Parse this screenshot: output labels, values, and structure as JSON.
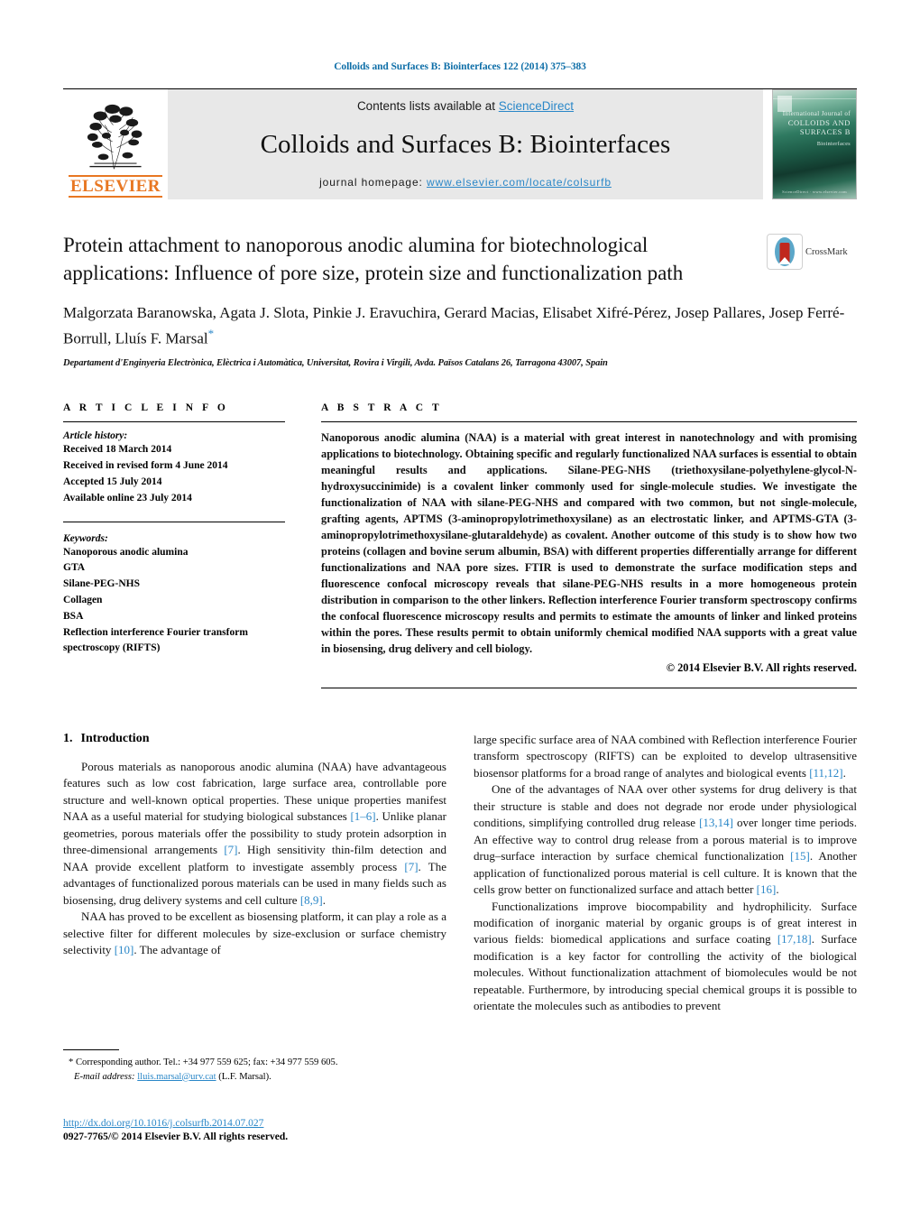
{
  "running_head": "Colloids and Surfaces B: Biointerfaces 122 (2014) 375–383",
  "banner": {
    "contents_prefix": "Contents lists available at ",
    "sciencedirect": "ScienceDirect",
    "journal_title": "Colloids and Surfaces B: Biointerfaces",
    "homepage_prefix": "journal homepage: ",
    "homepage_url": "www.elsevier.com/locate/colsurfb",
    "publisher": "ELSEVIER",
    "cover_title_line1": "International Journal of",
    "cover_title_line2": "COLLOIDS AND",
    "cover_title_line3": "SURFACES B",
    "cover_subtitle": "Biointerfaces",
    "cover_footer": "ScienceDirect  ·  www.elsevier.com"
  },
  "article": {
    "title": "Protein attachment to nanoporous anodic alumina for biotechnological applications: Influence of pore size, protein size and functionalization path",
    "crossmark_label": "CrossMark",
    "authors": "Malgorzata Baranowska, Agata J. Slota, Pinkie J. Eravuchira, Gerard Macias, Elisabet Xifré-Pérez, Josep Pallares, Josep Ferré-Borrull, Lluís F. Marsal",
    "corresponding_marker": "*",
    "affiliation": "Departament d'Enginyeria Electrònica, Elèctrica i Automàtica, Universitat, Rovira i Virgili, Avda. Països Catalans 26, Tarragona 43007, Spain"
  },
  "article_info": {
    "heading": "A R T I C L E    I N F O",
    "history_label": "Article history:",
    "history": [
      "Received 18 March 2014",
      "Received in revised form 4 June 2014",
      "Accepted 15 July 2014",
      "Available online 23 July 2014"
    ],
    "keywords_label": "Keywords:",
    "keywords": [
      "Nanoporous anodic alumina",
      "GTA",
      "Silane-PEG-NHS",
      "Collagen",
      "BSA",
      "Reflection interference Fourier transform spectroscopy (RIFTS)"
    ]
  },
  "abstract": {
    "heading": "A B S T R A C T",
    "body": "Nanoporous anodic alumina (NAA) is a material with great interest in nanotechnology and with promising applications to biotechnology. Obtaining specific and regularly functionalized NAA surfaces is essential to obtain meaningful results and applications. Silane-PEG-NHS (triethoxysilane-polyethylene-glycol-N-hydroxysuccinimide) is a covalent linker commonly used for single-molecule studies. We investigate the functionalization of NAA with silane-PEG-NHS and compared with two common, but not single-molecule, grafting agents, APTMS (3-aminopropylotrimethoxysilane) as an electrostatic linker, and APTMS-GTA (3-aminopropylotrimethoxysilane-glutaraldehyde) as covalent. Another outcome of this study is to show how two proteins (collagen and bovine serum albumin, BSA) with different properties differentially arrange for different functionalizations and NAA pore sizes. FTIR is used to demonstrate the surface modification steps and fluorescence confocal microscopy reveals that silane-PEG-NHS results in a more homogeneous protein distribution in comparison to the other linkers. Reflection interference Fourier transform spectroscopy confirms the confocal fluorescence microscopy results and permits to estimate the amounts of linker and linked proteins within the pores. These results permit to obtain uniformly chemical modified NAA supports with a great value in biosensing, drug delivery and cell biology.",
    "copyright": "© 2014 Elsevier B.V. All rights reserved."
  },
  "introduction": {
    "number": "1.",
    "heading": "Introduction",
    "left_paragraphs": [
      "Porous materials as nanoporous anodic alumina (NAA) have advantageous features such as low cost fabrication, large surface area, controllable pore structure and well-known optical properties. These unique properties manifest NAA as a useful material for studying biological substances [1–6]. Unlike planar geometries, porous materials offer the possibility to study protein adsorption in three-dimensional arrangements [7]. High sensitivity thin-film detection and NAA provide excellent platform to investigate assembly process [7]. The advantages of functionalized porous materials can be used in many fields such as biosensing, drug delivery systems and cell culture [8,9].",
      "NAA has proved to be excellent as biosensing platform, it can play a role as a selective filter for different molecules by size-exclusion or surface chemistry selectivity [10]. The advantage of"
    ],
    "right_paragraphs": [
      "large specific surface area of NAA combined with Reflection interference Fourier transform spectroscopy (RIFTS) can be exploited to develop ultrasensitive biosensor platforms for a broad range of analytes and biological events [11,12].",
      "One of the advantages of NAA over other systems for drug delivery is that their structure is stable and does not degrade nor erode under physiological conditions, simplifying controlled drug release [13,14] over longer time periods. An effective way to control drug release from a porous material is to improve drug–surface interaction by surface chemical functionalization [15]. Another application of functionalized porous material is cell culture. It is known that the cells grow better on functionalized surface and attach better [16].",
      "Functionalizations improve biocompability and hydrophilicity. Surface modification of inorganic material by organic groups is of great interest in various fields: biomedical applications and surface coating [17,18]. Surface modification is a key factor for controlling the activity of the biological molecules. Without functionalization attachment of biomolecules would be not repeatable. Furthermore, by introducing special chemical groups it is possible to orientate the molecules such as antibodies to prevent"
    ]
  },
  "footnote": {
    "marker": "*",
    "corresponding": "Corresponding author. Tel.: +34 977 559 625; fax: +34 977 559 605.",
    "email_label": "E-mail address:",
    "email": "lluis.marsal@urv.cat",
    "email_owner": "(L.F. Marsal)."
  },
  "bottom": {
    "doi": "http://dx.doi.org/10.1016/j.colsurfb.2014.07.027",
    "issn_line": "0927-7765/© 2014 Elsevier B.V. All rights reserved."
  },
  "colors": {
    "link_blue": "#2a87c8",
    "header_blue": "#0f6fa8",
    "elsevier_orange": "#E87722",
    "banner_grey": "#e8e8e8"
  }
}
